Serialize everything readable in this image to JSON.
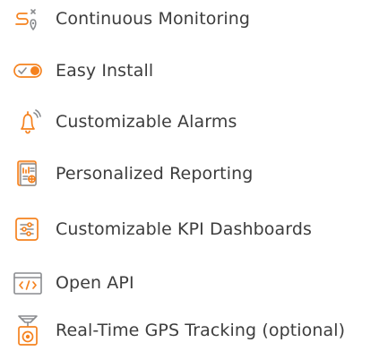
{
  "colors": {
    "accent": "#f5821f",
    "icon_gray": "#8a8c8f",
    "text": "#3d3d3d",
    "background": "#ffffff"
  },
  "features": [
    {
      "label": "Continuous Monitoring",
      "icon": "route-monitoring-icon"
    },
    {
      "label": "Easy Install",
      "icon": "toggle-check-icon"
    },
    {
      "label": "Customizable Alarms",
      "icon": "bell-alarm-icon"
    },
    {
      "label": "Personalized Reporting",
      "icon": "report-document-icon"
    },
    {
      "label": "Customizable KPI Dashboards",
      "icon": "sliders-dashboard-icon"
    },
    {
      "label": "Open API",
      "icon": "code-window-icon"
    },
    {
      "label": "Real-Time GPS Tracking (optional)",
      "icon": "gps-tracker-icon"
    }
  ]
}
